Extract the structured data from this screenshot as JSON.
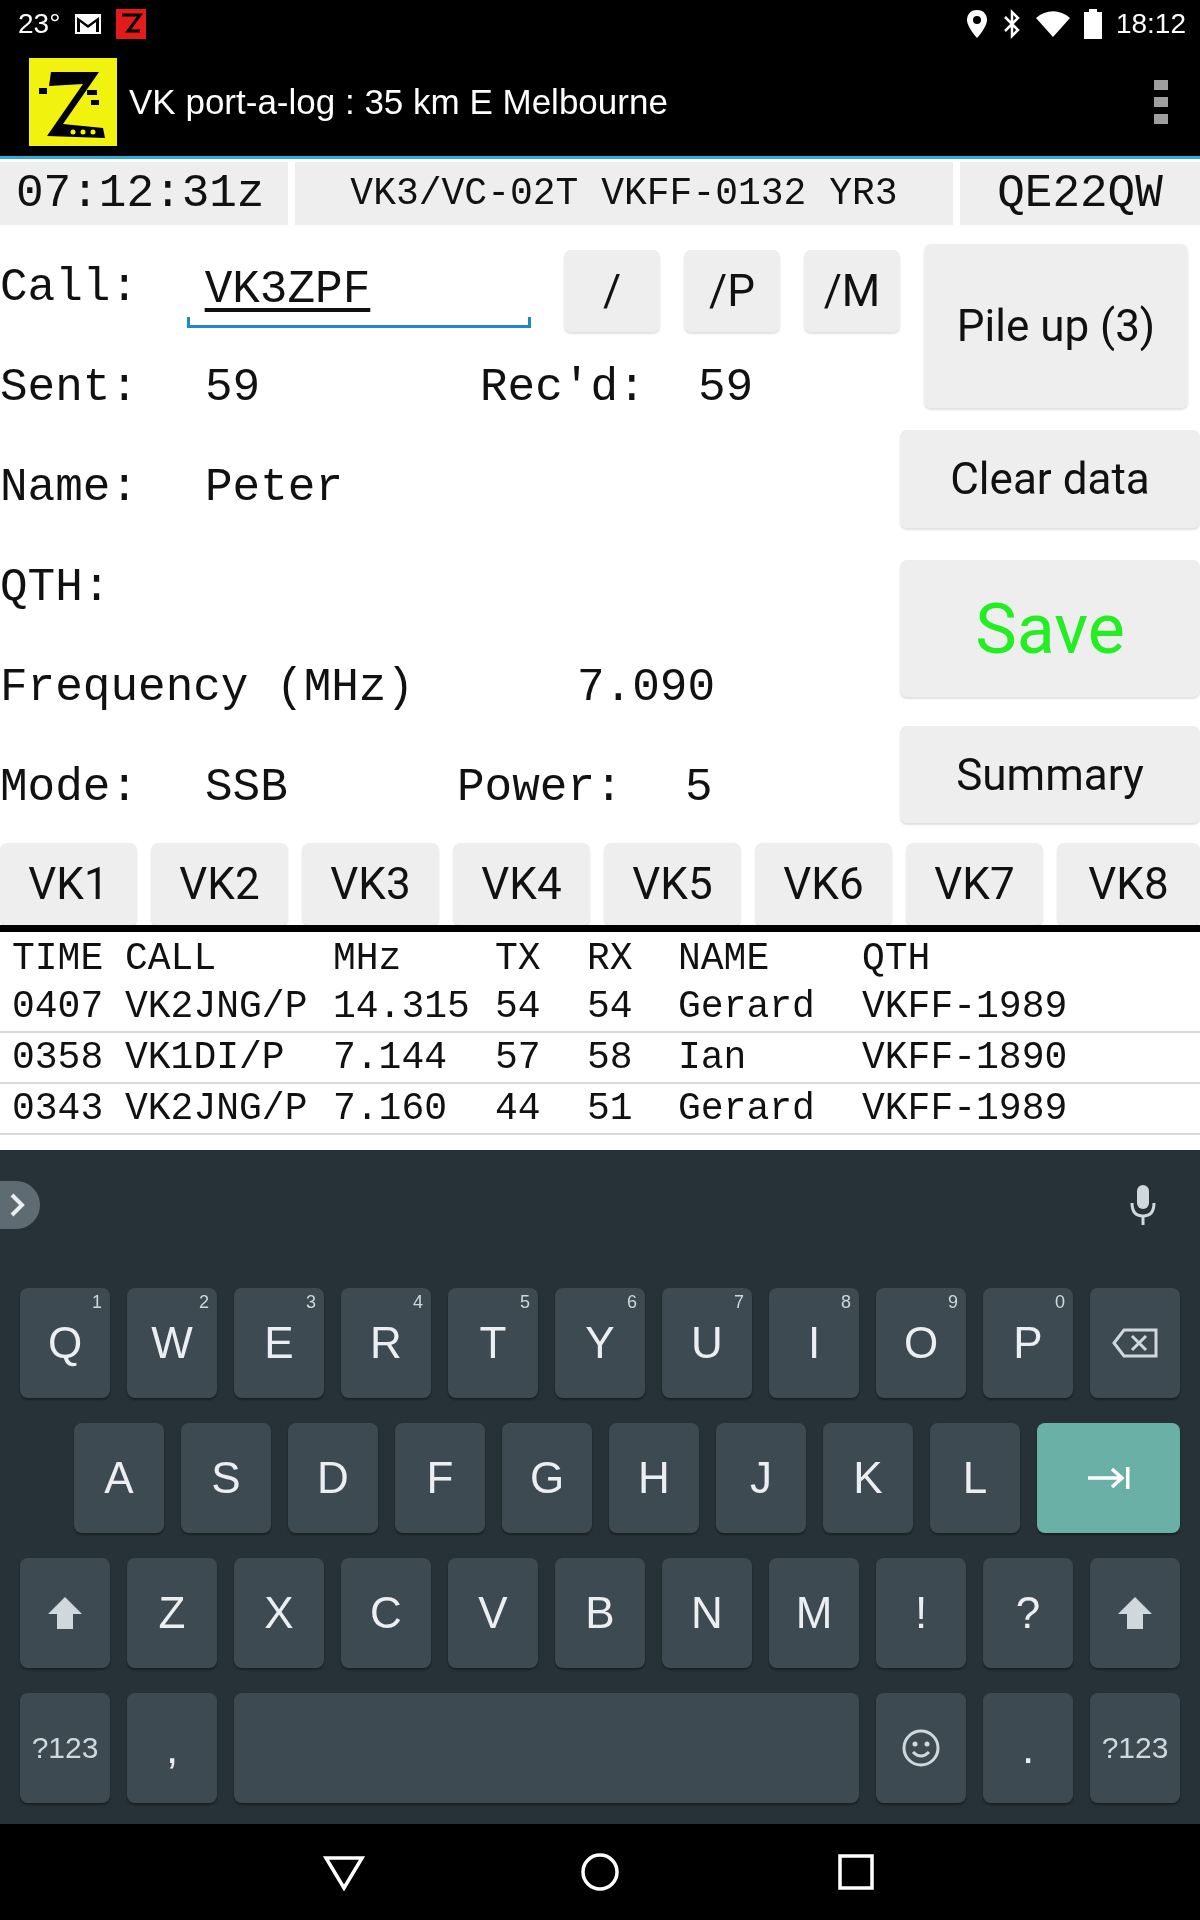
{
  "status_bar": {
    "temperature": "23°",
    "time": "18:12"
  },
  "app_bar": {
    "title": "VK port-a-log : 35 km E Melbourne"
  },
  "info_bar": {
    "time": "07:12:31z",
    "reference": "VK3/VC-02T VKFF-0132 YR3",
    "grid": "QE22QW"
  },
  "form": {
    "call": {
      "label": "Call:",
      "value": "VK3ZPF"
    },
    "sent": {
      "label": "Sent:",
      "value": "59"
    },
    "received": {
      "label": "Rec'd:",
      "value": "59"
    },
    "name": {
      "label": "Name:",
      "value": "Peter"
    },
    "qth": {
      "label": "QTH:"
    },
    "frequency": {
      "label": "Frequency (MHz)",
      "value": "7.090"
    },
    "mode": {
      "label": "Mode:",
      "value": "SSB"
    },
    "power": {
      "label": "Power:",
      "value": "5"
    }
  },
  "suffix_buttons": [
    "/",
    "/P",
    "/M"
  ],
  "action_buttons": [
    {
      "label": "Pile up (3)",
      "kind": "pileup"
    },
    {
      "label": "Clear data",
      "kind": "plain"
    },
    {
      "label": "Save",
      "kind": "save"
    },
    {
      "label": "Summary",
      "kind": "plain"
    }
  ],
  "area_buttons": [
    "VK1",
    "VK2",
    "VK3",
    "VK4",
    "VK5",
    "VK6",
    "VK7",
    "VK8"
  ],
  "log": {
    "columns": [
      "TIME",
      "CALL",
      "MHz",
      "TX",
      "RX",
      "NAME",
      "QTH"
    ],
    "rows": [
      [
        "0407",
        "VK2JNG/P",
        "14.315",
        "54",
        "54",
        "Gerard",
        "VKFF-1989"
      ],
      [
        "0358",
        "VK1DI/P",
        "7.144",
        "57",
        "58",
        "Ian",
        "VKFF-1890"
      ],
      [
        "0343",
        "VK2JNG/P",
        "7.160",
        "44",
        "51",
        "Gerard",
        "VKFF-1989"
      ]
    ]
  },
  "keyboard": {
    "rows": [
      {
        "keys": [
          {
            "kind": "letter",
            "label": "Q",
            "hint": "1"
          },
          {
            "kind": "letter",
            "label": "W",
            "hint": "2"
          },
          {
            "kind": "letter",
            "label": "E",
            "hint": "3"
          },
          {
            "kind": "letter",
            "label": "R",
            "hint": "4"
          },
          {
            "kind": "letter",
            "label": "T",
            "hint": "5"
          },
          {
            "kind": "letter",
            "label": "Y",
            "hint": "6"
          },
          {
            "kind": "letter",
            "label": "U",
            "hint": "7"
          },
          {
            "kind": "letter",
            "label": "I",
            "hint": "8"
          },
          {
            "kind": "letter",
            "label": "O",
            "hint": "9"
          },
          {
            "kind": "letter",
            "label": "P",
            "hint": "0"
          },
          {
            "kind": "backspace"
          }
        ]
      },
      {
        "keys": [
          {
            "kind": "letter",
            "label": "A"
          },
          {
            "kind": "letter",
            "label": "S"
          },
          {
            "kind": "letter",
            "label": "D"
          },
          {
            "kind": "letter",
            "label": "F"
          },
          {
            "kind": "letter",
            "label": "G"
          },
          {
            "kind": "letter",
            "label": "H"
          },
          {
            "kind": "letter",
            "label": "J"
          },
          {
            "kind": "letter",
            "label": "K"
          },
          {
            "kind": "letter",
            "label": "L"
          },
          {
            "kind": "enter"
          }
        ]
      },
      {
        "keys": [
          {
            "kind": "shift"
          },
          {
            "kind": "letter",
            "label": "Z"
          },
          {
            "kind": "letter",
            "label": "X"
          },
          {
            "kind": "letter",
            "label": "C"
          },
          {
            "kind": "letter",
            "label": "V"
          },
          {
            "kind": "letter",
            "label": "B"
          },
          {
            "kind": "letter",
            "label": "N"
          },
          {
            "kind": "letter",
            "label": "M"
          },
          {
            "kind": "letter",
            "label": "!"
          },
          {
            "kind": "letter",
            "label": "?"
          },
          {
            "kind": "shift"
          }
        ]
      },
      {
        "keys": [
          {
            "kind": "symbols",
            "label": "?123"
          },
          {
            "kind": "letter",
            "label": ","
          },
          {
            "kind": "space"
          },
          {
            "kind": "emoji"
          },
          {
            "kind": "letter",
            "label": "."
          },
          {
            "kind": "symbols",
            "label": "?123"
          }
        ]
      }
    ]
  }
}
